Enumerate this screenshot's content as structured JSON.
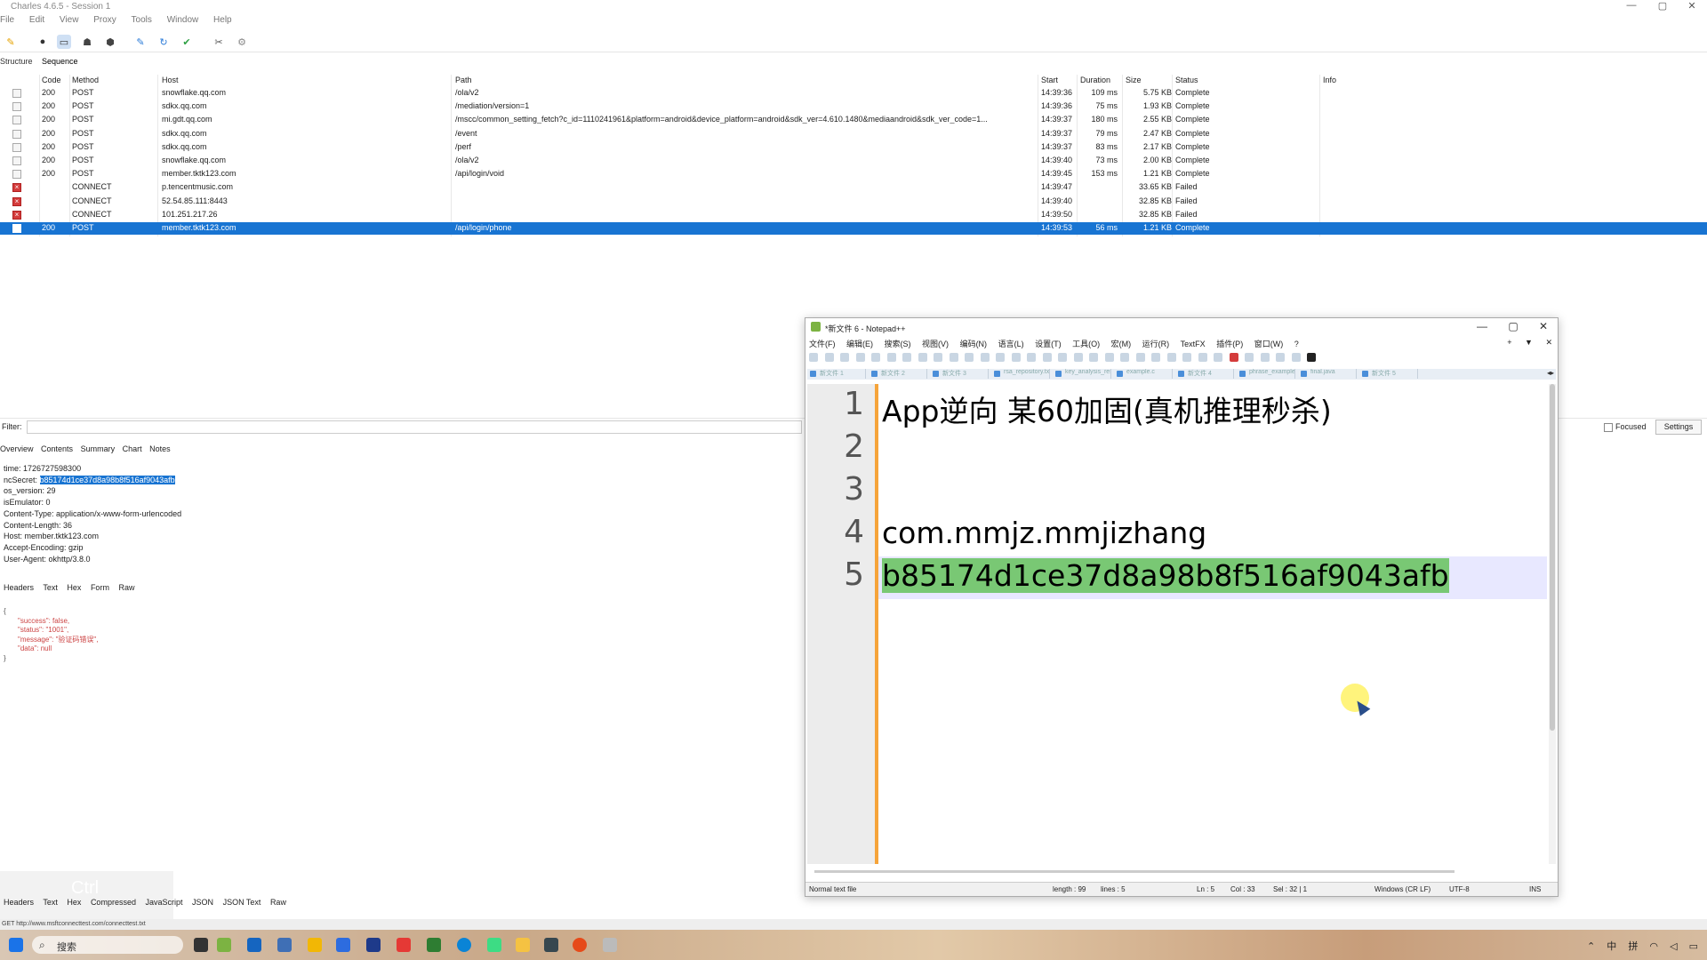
{
  "charles": {
    "title": "Charles 4.6.5 - Session 1",
    "menu": [
      "File",
      "Edit",
      "View",
      "Proxy",
      "Tools",
      "Window",
      "Help"
    ],
    "view_tabs": [
      "Structure",
      "Sequence"
    ],
    "columns": [
      "Code",
      "Method",
      "Host",
      "Path",
      "Start",
      "Duration",
      "Size",
      "Status",
      "Info"
    ],
    "rows": [
      {
        "code": "200",
        "method": "POST",
        "host": "snowflake.qq.com",
        "path": "/ola/v2",
        "start": "14:39:36",
        "duration": "109 ms",
        "size": "5.75 KB",
        "status": "Complete",
        "failed": false
      },
      {
        "code": "200",
        "method": "POST",
        "host": "sdkx.qq.com",
        "path": "/mediation/version=1",
        "start": "14:39:36",
        "duration": "75 ms",
        "size": "1.93 KB",
        "status": "Complete",
        "failed": false
      },
      {
        "code": "200",
        "method": "POST",
        "host": "mi.gdt.qq.com",
        "path": "/mscc/common_setting_fetch?c_id=1110241961&platform=android&device_platform=android&sdk_ver=4.610.1480&mediaandroid&sdk_ver_code=1...",
        "start": "14:39:37",
        "duration": "180 ms",
        "size": "2.55 KB",
        "status": "Complete",
        "failed": false
      },
      {
        "code": "200",
        "method": "POST",
        "host": "sdkx.qq.com",
        "path": "/event",
        "start": "14:39:37",
        "duration": "79 ms",
        "size": "2.47 KB",
        "status": "Complete",
        "failed": false
      },
      {
        "code": "200",
        "method": "POST",
        "host": "sdkx.qq.com",
        "path": "/perf",
        "start": "14:39:37",
        "duration": "83 ms",
        "size": "2.17 KB",
        "status": "Complete",
        "failed": false
      },
      {
        "code": "200",
        "method": "POST",
        "host": "snowflake.qq.com",
        "path": "/ola/v2",
        "start": "14:39:40",
        "duration": "73 ms",
        "size": "2.00 KB",
        "status": "Complete",
        "failed": false
      },
      {
        "code": "200",
        "method": "POST",
        "host": "member.tktk123.com",
        "path": "/api/login/void",
        "start": "14:39:45",
        "duration": "153 ms",
        "size": "1.21 KB",
        "status": "Complete",
        "failed": false
      },
      {
        "code": "",
        "method": "CONNECT",
        "host": "p.tencentmusic.com",
        "path": "",
        "start": "14:39:47",
        "duration": "",
        "size": "33.65 KB",
        "status": "Failed",
        "failed": true
      },
      {
        "code": "",
        "method": "CONNECT",
        "host": "52.54.85.111:8443",
        "path": "",
        "start": "14:39:40",
        "duration": "",
        "size": "32.85 KB",
        "status": "Failed",
        "failed": true
      },
      {
        "code": "",
        "method": "CONNECT",
        "host": "101.251.217.26",
        "path": "",
        "start": "14:39:50",
        "duration": "",
        "size": "32.85 KB",
        "status": "Failed",
        "failed": true
      },
      {
        "code": "200",
        "method": "POST",
        "host": "member.tktk123.com",
        "path": "/api/login/phone",
        "start": "14:39:53",
        "duration": "56 ms",
        "size": "1.21 KB",
        "status": "Complete",
        "failed": false,
        "selected": true
      }
    ],
    "filter_label": "Filter:",
    "focused_label": "Focused",
    "settings_label": "Settings",
    "detail_tabs": [
      "Overview",
      "Contents",
      "Summary",
      "Chart",
      "Notes"
    ],
    "request_lines": {
      "time": "time: 1726727598300",
      "secret_label": "ncSecret: ",
      "secret_value": "b85174d1ce37d8a98b8f516af9043afb",
      "os_version": "os_version: 29",
      "emulator": "isEmulator: 0",
      "content_type": "Content-Type: application/x-www-form-urlencoded",
      "content_length": "Content-Length: 36",
      "host": "Host: member.tktk123.com",
      "accept_encoding": "Accept-Encoding: gzip",
      "user_agent": "User-Agent: okhttp/3.8.0"
    },
    "mid_tabs": [
      "Headers",
      "Text",
      "Hex",
      "Form",
      "Raw"
    ],
    "response_json": {
      "open": "{",
      "success": "\"success\": false,",
      "status": "\"status\": \"1001\",",
      "message": "\"message\": \"验证码错误\",",
      "data": "\"data\": null",
      "close": "}"
    },
    "bottom_tabs": [
      "Headers",
      "Text",
      "Hex",
      "Compressed",
      "JavaScript",
      "JSON",
      "JSON Text",
      "Raw"
    ],
    "ctrl_hint": "Ctrl",
    "status_url": "GET http://www.msftconnecttest.com/connecttest.txt"
  },
  "notepad": {
    "title": "*新文件 6 - Notepad++",
    "menu": [
      "文件(F)",
      "编辑(E)",
      "搜索(S)",
      "视图(V)",
      "编码(N)",
      "语言(L)",
      "设置(T)",
      "工具(O)",
      "宏(M)",
      "运行(R)",
      "TextFX",
      "插件(P)",
      "窗口(W)",
      "?"
    ],
    "menu_controls": [
      "+",
      "▼",
      "✕"
    ],
    "tabs": [
      "新文件 1",
      "新文件 2",
      "新文件 3",
      "rsa_repository.txt",
      "key_analysis_results.txt",
      "example.c",
      "新文件 4",
      "phrase_example.c",
      "final.java",
      "新文件 5"
    ],
    "line_numbers": [
      "1",
      "2",
      "3",
      "4",
      "5"
    ],
    "lines": [
      "App逆向 某60加固(真机推理秒杀)",
      "",
      "",
      "com.mmjz.mmjizhang",
      "b85174d1ce37d8a98b8f516af9043afb"
    ],
    "status": {
      "type": "Normal text file",
      "length": "length : 99",
      "lines": "lines : 5",
      "ln": "Ln : 5",
      "col": "Col : 33",
      "sel": "Sel : 32 | 1",
      "eol": "Windows (CR LF)",
      "encoding": "UTF-8",
      "mode": "INS"
    },
    "selection_color": "#79c874",
    "fold_color": "#f6a43a"
  },
  "taskbar": {
    "search_placeholder": "搜索",
    "tray": [
      "中",
      "拼"
    ]
  },
  "colors": {
    "selection_blue": "#1874d2",
    "failed_red": "#d43c3c"
  }
}
